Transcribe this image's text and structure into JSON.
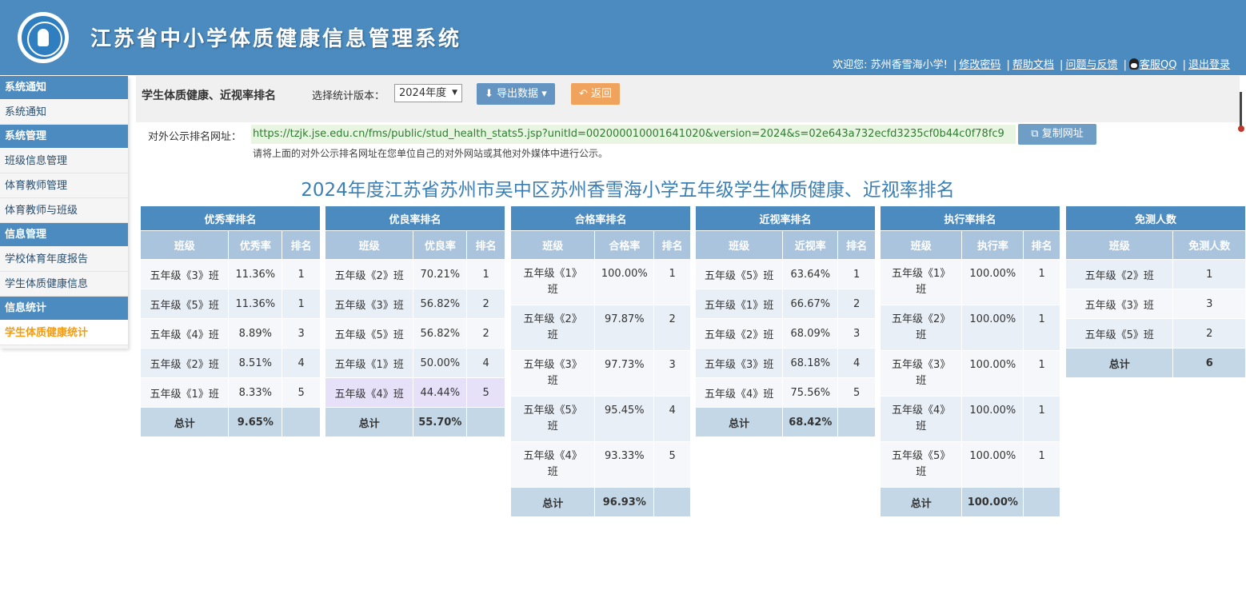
{
  "header": {
    "title": "江苏省中小学体质健康信息管理系统",
    "welcome": "欢迎您: 苏州香雪海小学!",
    "links": {
      "change_password": "修改密码",
      "help_docs": "帮助文档",
      "feedback": "问题与反馈",
      "qq": "客服QQ",
      "logout": "退出登录"
    }
  },
  "sidebar": {
    "groups": [
      {
        "title": "系统通知",
        "items": [
          "系统通知"
        ]
      },
      {
        "title": "系统管理",
        "items": [
          "班级信息管理",
          "体育教师管理",
          "体育教师与班级"
        ]
      },
      {
        "title": "信息管理",
        "items": [
          "学校体育年度报告",
          "学生体质健康信息"
        ]
      },
      {
        "title": "信息统计",
        "items": [
          "学生体质健康统计"
        ]
      }
    ],
    "active": "学生体质健康统计"
  },
  "toolbar": {
    "title": "学生体质健康、近视率排名",
    "version_label": "选择统计版本：",
    "version_value": "2024年度",
    "export_label": "导出数据",
    "back_label": "返回"
  },
  "public_url": {
    "label": "对外公示排名网址：",
    "url": "https://tzjk.jse.edu.cn/fms/public/stud_health_stats5.jsp?unitId=002000010001641020&version=2024&s=02e643a732ecfd3235cf0b44c0f78fc9",
    "copy_label": "复制网址",
    "hint": "请将上面的对外公示排名网址在您单位自己的对外网站或其他对外媒体中进行公示。"
  },
  "report_title": "2024年度江苏省苏州市吴中区苏州香雪海小学五年级学生体质健康、近视率排名",
  "tables": {
    "excellent": {
      "title": "优秀率排名",
      "headers": [
        "班级",
        "优秀率",
        "排名"
      ],
      "rows": [
        [
          "五年级《3》班",
          "11.36%",
          "1"
        ],
        [
          "五年级《5》班",
          "11.36%",
          "1"
        ],
        [
          "五年级《4》班",
          "8.89%",
          "3"
        ],
        [
          "五年级《2》班",
          "8.51%",
          "4"
        ],
        [
          "五年级《1》班",
          "8.33%",
          "5"
        ]
      ],
      "total": [
        "总计",
        "9.65%",
        ""
      ]
    },
    "good": {
      "title": "优良率排名",
      "headers": [
        "班级",
        "优良率",
        "排名"
      ],
      "rows": [
        [
          "五年级《2》班",
          "70.21%",
          "1"
        ],
        [
          "五年级《3》班",
          "56.82%",
          "2"
        ],
        [
          "五年级《5》班",
          "56.82%",
          "2"
        ],
        [
          "五年级《1》班",
          "50.00%",
          "4"
        ],
        [
          "五年级《4》班",
          "44.44%",
          "5"
        ]
      ],
      "total": [
        "总计",
        "55.70%",
        ""
      ]
    },
    "pass": {
      "title": "合格率排名",
      "headers": [
        "班级",
        "合格率",
        "排名"
      ],
      "rows": [
        [
          "五年级《1》\n班",
          "100.00%",
          "1"
        ],
        [
          "五年级《2》\n班",
          "97.87%",
          "2"
        ],
        [
          "五年级《3》\n班",
          "97.73%",
          "3"
        ],
        [
          "五年级《5》\n班",
          "95.45%",
          "4"
        ],
        [
          "五年级《4》\n班",
          "93.33%",
          "5"
        ]
      ],
      "total": [
        "总计",
        "96.93%",
        ""
      ]
    },
    "myopia": {
      "title": "近视率排名",
      "headers": [
        "班级",
        "近视率",
        "排名"
      ],
      "rows": [
        [
          "五年级《5》班",
          "63.64%",
          "1"
        ],
        [
          "五年级《1》班",
          "66.67%",
          "2"
        ],
        [
          "五年级《2》班",
          "68.09%",
          "3"
        ],
        [
          "五年级《3》班",
          "68.18%",
          "4"
        ],
        [
          "五年级《4》班",
          "75.56%",
          "5"
        ]
      ],
      "total": [
        "总计",
        "68.42%",
        ""
      ]
    },
    "execution": {
      "title": "执行率排名",
      "headers": [
        "班级",
        "执行率",
        "排名"
      ],
      "rows": [
        [
          "五年级《1》\n班",
          "100.00%",
          "1"
        ],
        [
          "五年级《2》\n班",
          "100.00%",
          "1"
        ],
        [
          "五年级《3》\n班",
          "100.00%",
          "1"
        ],
        [
          "五年级《4》\n班",
          "100.00%",
          "1"
        ],
        [
          "五年级《5》\n班",
          "100.00%",
          "1"
        ]
      ],
      "total": [
        "总计",
        "100.00%",
        ""
      ]
    },
    "exempt": {
      "title": "免测人数",
      "headers": [
        "班级",
        "免测人数"
      ],
      "rows": [
        [
          "五年级《2》班",
          "1"
        ],
        [
          "五年级《3》班",
          "3"
        ],
        [
          "五年级《5》班",
          "2"
        ]
      ],
      "total": [
        "总计",
        "6"
      ]
    }
  }
}
